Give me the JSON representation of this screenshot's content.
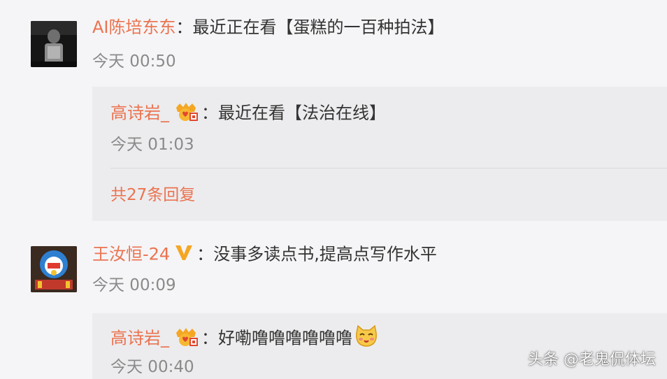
{
  "comments": [
    {
      "user": "AI陈培东东",
      "colon": "：",
      "text": "最近正在看【蛋糕的一百种拍法】",
      "time": "今天 00:50",
      "reply": {
        "user": "高诗岩_",
        "badge_icon": "crown-heart-badge-icon",
        "colon": "：",
        "text": "最近在看【法治在线】",
        "time": "今天 01:03"
      },
      "more_replies": "共27条回复"
    },
    {
      "user": "王汝恒-24",
      "badge_icon": "verified-v-badge-icon",
      "colon": "：",
      "text": "没事多读点书,提高点写作水平",
      "time": "今天 00:09",
      "reply": {
        "user": "高诗岩_",
        "badge_icon": "crown-heart-badge-icon",
        "colon": "：",
        "text": "好嘞噜噜噜噜噜噜",
        "emoji": "cat-face-emoji-icon",
        "time": "今天 00:40"
      }
    }
  ],
  "watermark": "头条 @老鬼侃体坛",
  "colors": {
    "username": "#eb7350",
    "text": "#333333",
    "time": "#8a8a8a",
    "reply_bg": "#ececee",
    "page_bg": "#f5f5f7",
    "verified": "#f5a623"
  }
}
